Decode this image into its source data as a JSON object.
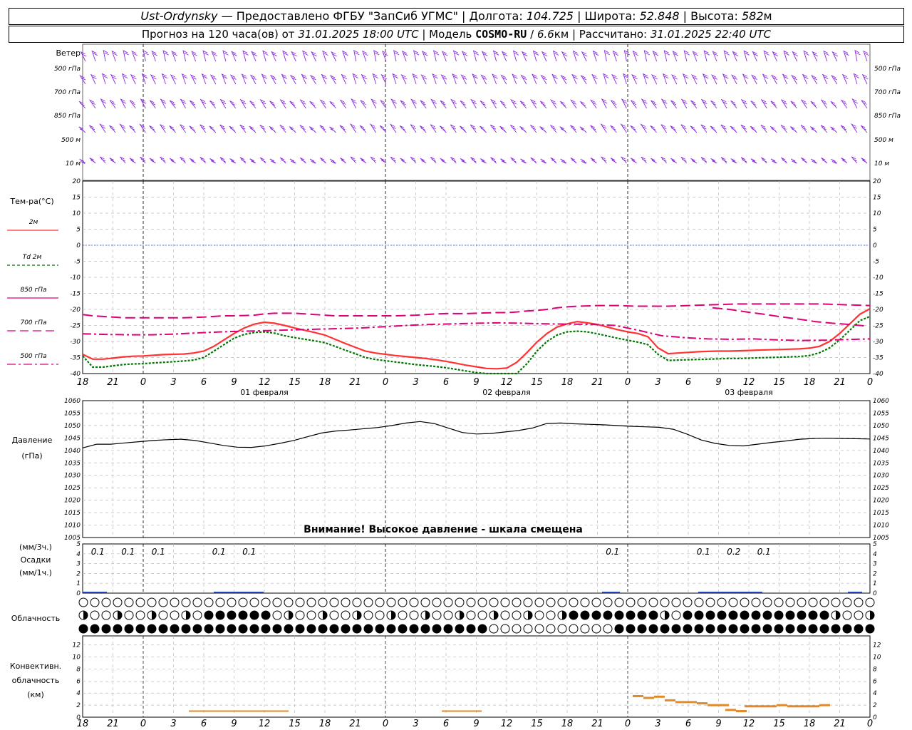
{
  "header": {
    "station": "Ust-Ordynsky",
    "provided": " — Предоставлено ФГБУ \"ЗапСиб УГМС\" | Долгота: ",
    "lon": "104.725",
    "lat_label": " | Широта: ",
    "lat": "52.848",
    "alt_label": " | Высота: ",
    "alt": "582",
    "alt_unit": "м",
    "forecast_label": "Прогноз на 120 часа(ов) от ",
    "forecast_from": "31.01.2025 18:00 UTC",
    "model_label": " | Модель ",
    "model": "COSMO-RU",
    "model_res_sep": " / ",
    "model_res": "6.6",
    "model_res_unit": "км | Рассчитано: ",
    "computed": "31.01.2025 22:40 UTC"
  },
  "wind_panel": {
    "title": "Ветер",
    "levels": [
      "500 гПа",
      "700 гПа",
      "850 гПа",
      "500 м",
      "10 м"
    ],
    "right_levels": [
      "500 гПа",
      "700 гПа",
      "850 гПа",
      "500 м",
      "10 м"
    ],
    "color": "#8a2be2"
  },
  "temp_panel": {
    "title": "Тем-ра(°C)",
    "legend": [
      {
        "label": "2м",
        "color": "#ff3333",
        "dash": ""
      },
      {
        "label": "Td 2м",
        "color": "#007700",
        "dash": "4,3"
      },
      {
        "label": "850 гПа",
        "color": "#dd0077",
        "dash": ""
      },
      {
        "label": "700 гПа",
        "color": "#dd0077",
        "dash": "12,6"
      },
      {
        "label": "500 гПа",
        "color": "#dd0077",
        "dash": "12,4,3,4"
      }
    ],
    "yticks": [
      20,
      15,
      10,
      5,
      0,
      -5,
      -10,
      -15,
      -20,
      -25,
      -30,
      -35,
      -40
    ]
  },
  "pressure_panel": {
    "title": "Давление",
    "unit": "(гПа)",
    "yticks": [
      1060,
      1055,
      1050,
      1045,
      1040,
      1035,
      1030,
      1025,
      1020,
      1015,
      1010,
      1005
    ],
    "warning": "Внимание! Высокое давление - шкала смещена"
  },
  "precip_panel": {
    "unit3": "(мм/3ч.)",
    "title": "Осадки",
    "unit1": "(мм/1ч.)",
    "yticks": [
      5,
      4,
      3,
      2,
      1,
      0
    ]
  },
  "cloud_panel": {
    "title": "Облачность"
  },
  "conv_panel": {
    "title1": "Конвективн.",
    "title2": "облачность",
    "unit": "(км)",
    "yticks": [
      12,
      10,
      8,
      6,
      4,
      2,
      0
    ]
  },
  "dates": [
    "01 февраля",
    "02 февраля",
    "03 февраля"
  ],
  "hour_ticks": [
    "18",
    "21",
    "0",
    "3",
    "6",
    "9",
    "12",
    "15",
    "18",
    "21",
    "0",
    "3",
    "6",
    "9",
    "12",
    "15",
    "18",
    "21",
    "0",
    "3",
    "6",
    "9",
    "12",
    "15",
    "18",
    "21",
    "0"
  ],
  "chart_data": {
    "type": "line",
    "x_hours_from_start": [
      0,
      1,
      2,
      3,
      4,
      5,
      6,
      7,
      8,
      9,
      10,
      11,
      12,
      13,
      14,
      15,
      16,
      17,
      18,
      19,
      20,
      21,
      22,
      23,
      24,
      25,
      26,
      27,
      28,
      29,
      30,
      31,
      32,
      33,
      34,
      35,
      36,
      37,
      38,
      39,
      40,
      41,
      42,
      43,
      44,
      45,
      46,
      47,
      48,
      49,
      50,
      51,
      52,
      53,
      54,
      55,
      56,
      57,
      58,
      59,
      60,
      61,
      62,
      63,
      64,
      65,
      66,
      67,
      68,
      69,
      70,
      71,
      72,
      73,
      74,
      75,
      76,
      77,
      78
    ],
    "series": [
      {
        "name": "2м",
        "color": "#ff3333",
        "values": [
          -34,
          -35.5,
          -35.5,
          -35.2,
          -34.8,
          -34.6,
          -34.5,
          -34.3,
          -34.1,
          -34,
          -33.9,
          -33.6,
          -33,
          -31.5,
          -29.5,
          -27.5,
          -25.8,
          -24.6,
          -24,
          -24.3,
          -25,
          -25.8,
          -26.5,
          -27.2,
          -28,
          -29.3,
          -30.6,
          -31.8,
          -33,
          -33.6,
          -34,
          -34.4,
          -34.7,
          -35,
          -35.3,
          -35.7,
          -36.2,
          -36.8,
          -37.4,
          -37.9,
          -38.4,
          -38.5,
          -38.3,
          -36.5,
          -33.5,
          -30.2,
          -27.5,
          -25.5,
          -24.5,
          -23.8,
          -24.2,
          -24.7,
          -25.5,
          -26.3,
          -27,
          -27.5,
          -28.5,
          -32,
          -33.8,
          -33.6,
          -33.4,
          -33.2,
          -33.1,
          -33,
          -33,
          -32.9,
          -32.8,
          -32.7,
          -32.6,
          -32.5,
          -32.4,
          -32.3,
          -32.1,
          -31.5,
          -30,
          -27.5,
          -24.5,
          -21.5,
          -19.8
        ]
      },
      {
        "name": "Td 2м",
        "color": "#007700",
        "values": [
          -34.5,
          -38,
          -38,
          -37.6,
          -37.2,
          -37,
          -36.9,
          -36.7,
          -36.5,
          -36.3,
          -36.1,
          -35.8,
          -35,
          -33,
          -31,
          -29,
          -27.8,
          -27.2,
          -27,
          -27.4,
          -28.2,
          -28.8,
          -29.3,
          -29.8,
          -30.4,
          -31.5,
          -32.7,
          -33.8,
          -35,
          -35.6,
          -36,
          -36.4,
          -36.8,
          -37.2,
          -37.5,
          -37.8,
          -38.2,
          -38.7,
          -39.2,
          -39.7,
          -40,
          -40,
          -40,
          -40,
          -37,
          -33,
          -30,
          -28,
          -27,
          -26.8,
          -27,
          -27.6,
          -28.3,
          -29,
          -29.6,
          -30.2,
          -31,
          -34,
          -35.9,
          -35.8,
          -35.7,
          -35.6,
          -35.5,
          -35.4,
          -35.3,
          -35.3,
          -35.2,
          -35.1,
          -35,
          -34.9,
          -34.8,
          -34.7,
          -34.4,
          -33.5,
          -32,
          -29.5,
          -26.5,
          -23.5,
          -22.2
        ]
      },
      {
        "name": "850 гПа",
        "color": "#dd0077",
        "values": [
          -21.6,
          -22,
          -22.2,
          -22.4,
          -22.6,
          -22.6,
          -22.6,
          -22.6,
          -22.6,
          -22.6,
          -22.6,
          -22.5,
          -22.4,
          -22.2,
          -22,
          -22,
          -21.9,
          -21.8,
          -21.4,
          -21.2,
          -21.2,
          -21.2,
          -21.4,
          -21.6,
          -21.8,
          -22,
          -22,
          -22,
          -22,
          -22,
          -22,
          -22,
          -21.9,
          -21.8,
          -21.6,
          -21.4,
          -21.3,
          -21.3,
          -21.3,
          -21.2,
          -21.1,
          -21,
          -21,
          -20.8,
          -20.5,
          -20.3,
          -20,
          -19.5,
          -19.2,
          -19,
          -18.9,
          -18.8,
          -18.8,
          -18.8,
          -18.9,
          -19,
          -19,
          -19,
          -19,
          -18.9,
          -18.8,
          -18.7,
          -18.6,
          -18.5,
          -18.4,
          -18.3,
          -18.3,
          -18.3,
          -18.3,
          -18.3,
          -18.3,
          -18.3,
          -18.3,
          -18.3,
          -18.4,
          -18.5,
          -18.6,
          -18.7,
          -18.8
        ]
      }
    ]
  }
}
